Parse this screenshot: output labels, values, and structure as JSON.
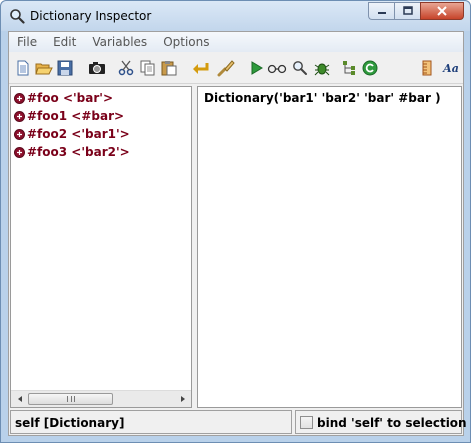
{
  "window": {
    "title": "Dictionary Inspector",
    "icon": "magnifier-icon"
  },
  "menu": [
    "File",
    "Edit",
    "Variables",
    "Options"
  ],
  "toolbar": {
    "icons": [
      "new-document-icon",
      "open-folder-icon",
      "save-disk-icon",
      "camera-icon",
      "cut-scissors-icon",
      "copy-icon",
      "paste-icon",
      "undo-arrow-icon",
      "brush-icon",
      "run-play-icon",
      "glasses-icon",
      "magnifier-icon",
      "bug-icon",
      "tree-icon",
      "refresh-icon",
      "ruler-icon",
      "font-aa-icon"
    ],
    "font_label": "Aa"
  },
  "keys": [
    {
      "label": "#foo <'bar'>"
    },
    {
      "label": "#foo1 <#bar>"
    },
    {
      "label": "#foo2 <'bar1'>"
    },
    {
      "label": "#foo3 <'bar2'>"
    }
  ],
  "editor": {
    "text": "Dictionary('bar1' 'bar2' 'bar' #bar )"
  },
  "status": {
    "self_label": "self [Dictionary]",
    "bind_label": "bind 'self' to selection",
    "bind_checked": false
  },
  "scrollbar": {
    "grip": "III"
  },
  "colors": {
    "key_text": "#7a0019",
    "titlebar": "#c2d6ec",
    "client_bg": "#f0f0f0"
  }
}
